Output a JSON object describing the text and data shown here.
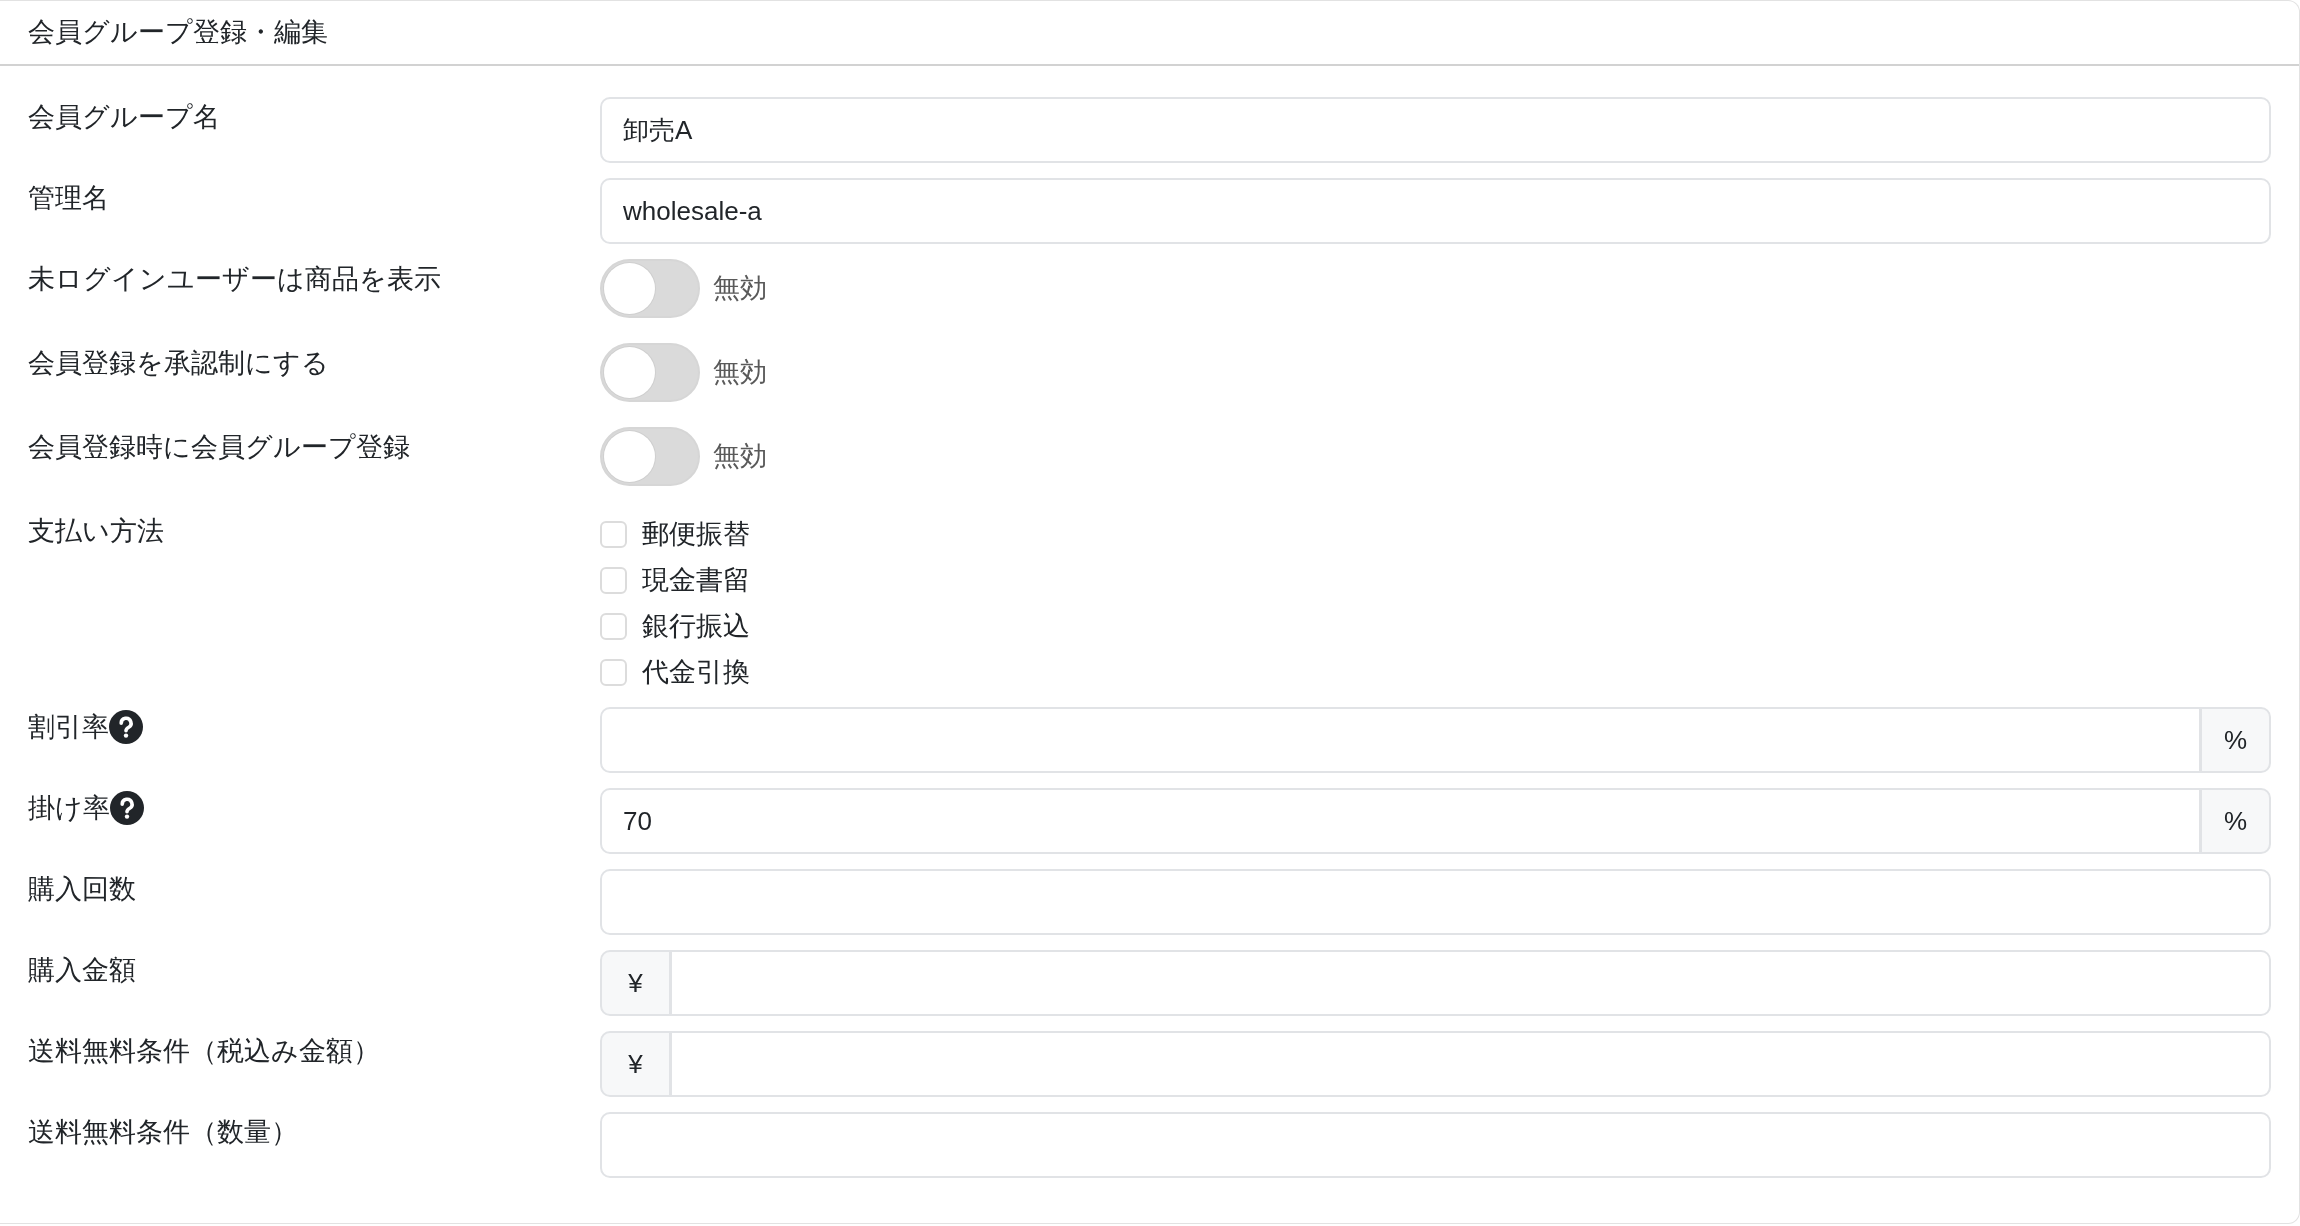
{
  "panel": {
    "title": "会員グループ登録・編集"
  },
  "fields": [
    {
      "kind": "text",
      "label": "会員グループ名",
      "value": "卸売A"
    },
    {
      "kind": "text",
      "label": "管理名",
      "value": "wholesale-a"
    },
    {
      "kind": "toggle",
      "label": "未ログインユーザーは商品を表示",
      "on": false,
      "status": "無効"
    },
    {
      "kind": "toggle",
      "label": "会員登録を承認制にする",
      "on": false,
      "status": "無効"
    },
    {
      "kind": "toggle",
      "label": "会員登録時に会員グループ登録",
      "on": false,
      "status": "無効"
    },
    {
      "kind": "checkboxes",
      "label": "支払い方法",
      "options": [
        {
          "label": "郵便振替",
          "checked": false
        },
        {
          "label": "現金書留",
          "checked": false
        },
        {
          "label": "銀行振込",
          "checked": false
        },
        {
          "label": "代金引換",
          "checked": false
        }
      ]
    },
    {
      "kind": "text",
      "label": "割引率",
      "help": true,
      "suffix": "%"
    },
    {
      "kind": "text",
      "label": "掛け率",
      "help": true,
      "value": "70",
      "suffix": "%"
    },
    {
      "kind": "text",
      "label": "購入回数"
    },
    {
      "kind": "text",
      "label": "購入金額",
      "prefix": "¥"
    },
    {
      "kind": "text",
      "label": "送料無料条件（税込み金額）",
      "prefix": "¥"
    },
    {
      "kind": "text",
      "label": "送料無料条件（数量）"
    }
  ]
}
